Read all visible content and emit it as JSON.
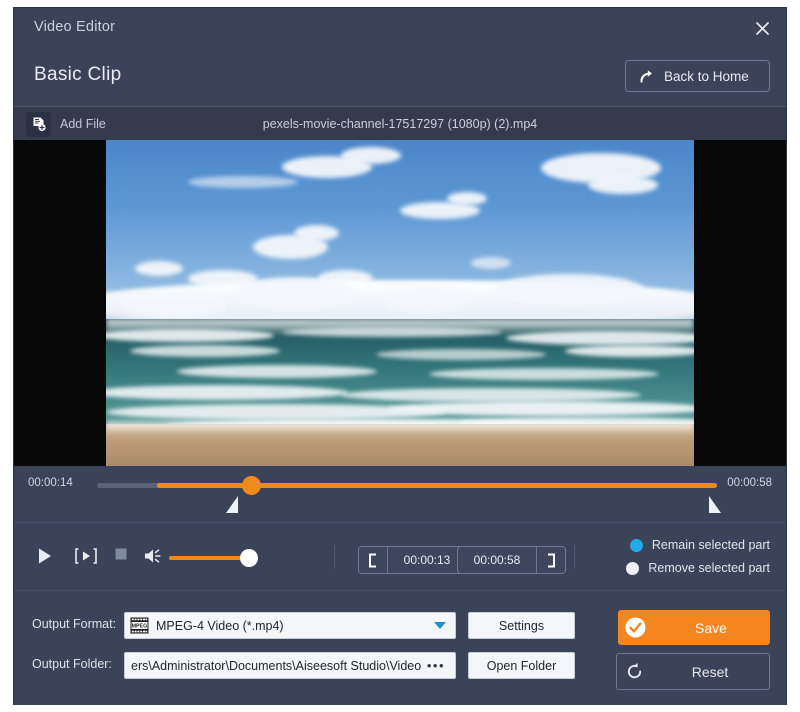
{
  "window": {
    "title": "Video Editor",
    "close_icon": "close-icon"
  },
  "header": {
    "page_title": "Basic Clip",
    "back_home_label": "Back to Home",
    "back_home_icon": "redo-arrow-icon"
  },
  "filebar": {
    "add_file_label": "Add File",
    "add_file_icon": "add-file-icon",
    "filename": "pexels-movie-channel-17517297 (1080p) (2).mp4"
  },
  "preview": {
    "scene": "ocean-beach-clouds"
  },
  "timeline": {
    "start_time": "00:00:14",
    "end_time": "00:00:58",
    "playhead_position_pct": 23,
    "selection_start_pct": 23,
    "selection_end_pct": 100,
    "accent_color": "#f08a1b"
  },
  "controls": {
    "play_icon": "play-icon",
    "frame_icon": "step-frame-icon",
    "stop_icon": "stop-icon",
    "volume_icon": "volume-icon",
    "volume_level_pct": 100,
    "trim_in_icon": "bracket-left-icon",
    "trim_in_value": "00:00:13",
    "trim_out_value": "00:00:58",
    "trim_out_icon": "bracket-right-icon",
    "options": [
      {
        "label": "Remain selected part",
        "selected": true
      },
      {
        "label": "Remove selected part",
        "selected": false
      }
    ],
    "radio_on_color": "#24a8e8",
    "radio_off_color": "#f0f2f6"
  },
  "output": {
    "format_label": "Output Format:",
    "format_value": "MPEG-4 Video (*.mp4)",
    "format_icon": "mpeg-film-icon",
    "settings_label": "Settings",
    "folder_label": "Output Folder:",
    "folder_value": "ers\\Administrator\\Documents\\Aiseesoft Studio\\Video",
    "browse_icon": "ellipsis-icon",
    "open_folder_label": "Open Folder"
  },
  "actions": {
    "save_label": "Save",
    "save_icon": "check-circle-icon",
    "save_color": "#f5861f",
    "reset_label": "Reset",
    "reset_icon": "reset-arrow-icon"
  }
}
